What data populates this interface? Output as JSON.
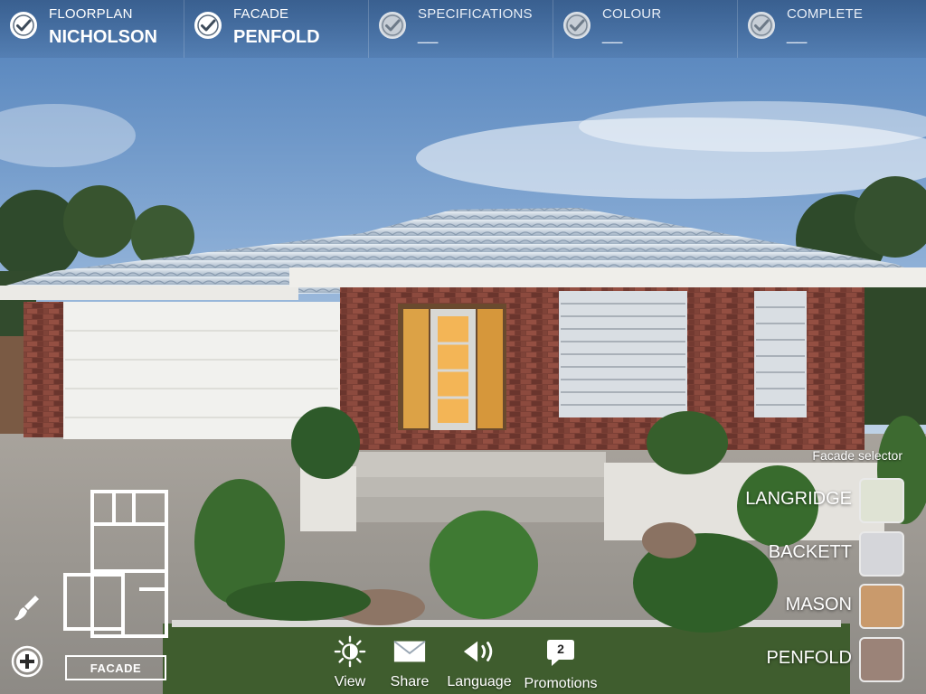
{
  "steps": [
    {
      "label": "FLOORPLAN",
      "value": "NICHOLSON",
      "done": true
    },
    {
      "label": "FACADE",
      "value": "PENFOLD",
      "done": true
    },
    {
      "label": "SPECIFICATIONS",
      "value": "__",
      "done": false
    },
    {
      "label": "COLOUR",
      "value": "__",
      "done": false
    },
    {
      "label": "COMPLETE",
      "value": "__",
      "done": false
    }
  ],
  "floorplan": {
    "button_label": "FACADE"
  },
  "toolbar": {
    "view": "View",
    "share": "Share",
    "language": "Language",
    "promotions": "Promotions",
    "promotions_badge": "2"
  },
  "facade_selector": {
    "title": "Facade selector",
    "options": [
      {
        "name": "LANGRIDGE",
        "color": "#dfe3d4"
      },
      {
        "name": "BACKETT",
        "color": "#d5d6da"
      },
      {
        "name": "MASON",
        "color": "#c99a6c"
      },
      {
        "name": "PENFOLD",
        "color": "#9b8378"
      }
    ]
  },
  "icons": {
    "step_check": "check-circle-icon",
    "left_tool": "paint-brush-icon",
    "add": "plus-circle-icon",
    "view": "sun-icon",
    "share": "envelope-icon",
    "language": "speaker-icon",
    "promotions": "speech-bubble-icon"
  }
}
